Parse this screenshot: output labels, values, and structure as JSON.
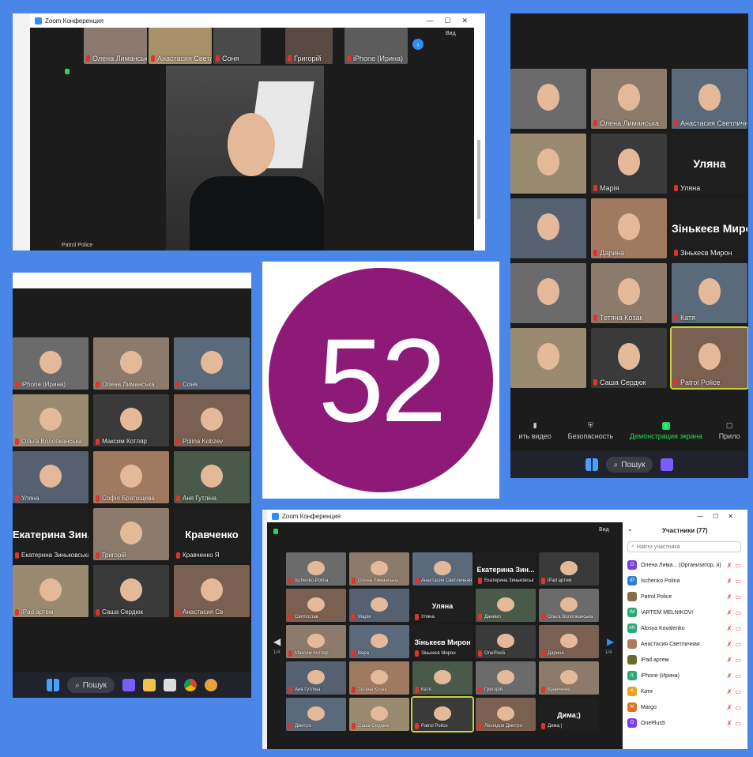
{
  "window_title": "Zoom Конференция",
  "win_ctrl": {
    "min": "—",
    "max": "☐",
    "close": "✕"
  },
  "view_label": "Вид",
  "top_panel": {
    "strip": [
      "Олена Лиманська",
      "Анастасия Светличн...",
      "Соня",
      "Григорій",
      "iPhone (Ирина)"
    ],
    "speaker_label": "Patrol Police"
  },
  "right_panel": {
    "tiles": [
      {
        "name": "",
        "big": ""
      },
      {
        "name": "Олена Лиманська",
        "big": ""
      },
      {
        "name": "Анастасия Светличная",
        "big": ""
      },
      {
        "name": "",
        "big": ""
      },
      {
        "name": "Марія",
        "big": ""
      },
      {
        "name": "Уляна",
        "big": "Уляна"
      },
      {
        "name": "",
        "big": ""
      },
      {
        "name": "Дарина",
        "big": ""
      },
      {
        "name": "Зінькеєв Мирон",
        "big": "Зінькеєв Мирон"
      },
      {
        "name": "",
        "big": ""
      },
      {
        "name": "Тетяна Козак",
        "big": ""
      },
      {
        "name": "Катя",
        "big": ""
      },
      {
        "name": "",
        "big": ""
      },
      {
        "name": "Саша Сердюк",
        "big": ""
      },
      {
        "name": "Patrol Police",
        "big": ""
      }
    ],
    "toolbar": [
      "ить видео",
      "Безопасность",
      "Демонстрация экрана",
      "Прило"
    ],
    "search_label": "Пошук"
  },
  "left_panel": {
    "tiles": [
      {
        "name": "iPhone (Ирина)",
        "big": ""
      },
      {
        "name": "Олена Лиманська",
        "big": ""
      },
      {
        "name": "Соня",
        "big": ""
      },
      {
        "name": "Ольга Вологжанська",
        "big": ""
      },
      {
        "name": "Максим Котляр",
        "big": ""
      },
      {
        "name": "Polina Kobzev",
        "big": ""
      },
      {
        "name": "Уляна",
        "big": ""
      },
      {
        "name": "Софія Братищева",
        "big": ""
      },
      {
        "name": "Аня Гутліна",
        "big": ""
      },
      {
        "name": "Екатерина Зиньковська",
        "big": "Екатерина Зин..."
      },
      {
        "name": "Григорій",
        "big": ""
      },
      {
        "name": "Кравченко Я",
        "big": "Кравченко"
      },
      {
        "name": "iPad артем",
        "big": ""
      },
      {
        "name": "Саша Сердюк",
        "big": ""
      },
      {
        "name": "Анастасия Св",
        "big": ""
      }
    ],
    "search_label": "Пошук"
  },
  "logo_text": "52",
  "bottom_panel": {
    "tiles": [
      {
        "name": "Ischenko Polina",
        "big": ""
      },
      {
        "name": "Олена Лиманська",
        "big": ""
      },
      {
        "name": "Анастасия Светличная",
        "big": ""
      },
      {
        "name": "Екатерина Зиньковськ",
        "big": "Екатерина Зин..."
      },
      {
        "name": "iPad артем",
        "big": ""
      },
      {
        "name": "Святослав",
        "big": ""
      },
      {
        "name": "Марія",
        "big": ""
      },
      {
        "name": "Уляна",
        "big": "Уляна"
      },
      {
        "name": "Даниил",
        "big": ""
      },
      {
        "name": "Ольга Вологжанська",
        "big": ""
      },
      {
        "name": "Максим Котляр",
        "big": ""
      },
      {
        "name": "Вера",
        "big": ""
      },
      {
        "name": "Зінькеєв Мирон",
        "big": "Зінькеєв Мирон"
      },
      {
        "name": "OnePlus5",
        "big": ""
      },
      {
        "name": "Дарина",
        "big": ""
      },
      {
        "name": "Аня Гутліна",
        "big": ""
      },
      {
        "name": "Тетяна Козак",
        "big": ""
      },
      {
        "name": "Катя",
        "big": ""
      },
      {
        "name": "Григорій",
        "big": ""
      },
      {
        "name": "Кравченко",
        "big": ""
      },
      {
        "name": "Дмитро",
        "big": ""
      },
      {
        "name": "Саша Сердюк",
        "big": ""
      },
      {
        "name": "Patrol Police",
        "big": ""
      },
      {
        "name": "Леонідов Дмитро",
        "big": ""
      },
      {
        "name": "Дима;)",
        "big": "Дима;)"
      }
    ],
    "page_left": "1/4",
    "page_right": "1/4",
    "participants": {
      "title": "Участники (77)",
      "search_placeholder": "Найти участника",
      "list": [
        {
          "initials": "O",
          "color": "#7b3fe4",
          "name": "Олена Лима... (Организатор, я)"
        },
        {
          "initials": "IP",
          "color": "#2e7dd7",
          "name": "Ischenko Polina"
        },
        {
          "initials": "",
          "color": "#8a6b3b",
          "name": "Patrol Police"
        },
        {
          "initials": "\\M",
          "color": "#2aa876",
          "name": "\\ARTEM MELNIKOV/"
        },
        {
          "initials": "AK",
          "color": "#2aa876",
          "name": "Alosya Kovalenko"
        },
        {
          "initials": "",
          "color": "#b07a5a",
          "name": "Анастасия Светличная"
        },
        {
          "initials": "",
          "color": "#6b6b2a",
          "name": "iPad артем"
        },
        {
          "initials": "I(",
          "color": "#2aa876",
          "name": "iPhone (Ирина)"
        },
        {
          "initials": "K",
          "color": "#f0a020",
          "name": "Катя"
        },
        {
          "initials": "M",
          "color": "#e07020",
          "name": "Margo"
        },
        {
          "initials": "O",
          "color": "#7b3fe4",
          "name": "OnePlus5"
        }
      ]
    }
  },
  "colors": {
    "background": "#4a86e8",
    "logo_circle": "#8e1a78",
    "zoom_green": "#23d959",
    "highlight": "#c9d13a"
  }
}
